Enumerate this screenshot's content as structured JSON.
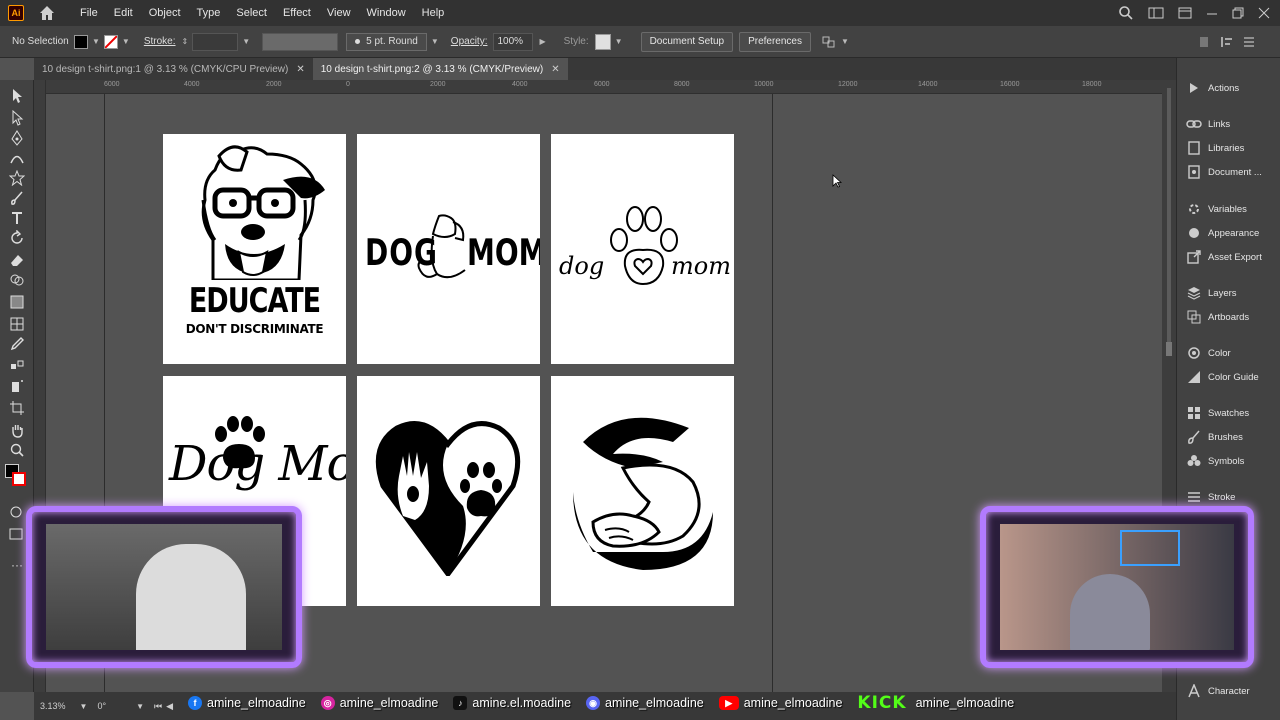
{
  "app": {
    "logo_text": "Ai",
    "menu": [
      "File",
      "Edit",
      "Object",
      "Type",
      "Select",
      "Effect",
      "View",
      "Window",
      "Help"
    ]
  },
  "options_bar": {
    "selection": "No Selection",
    "stroke_label": "Stroke:",
    "brush": "5 pt. Round",
    "opacity_label": "Opacity:",
    "opacity_value": "100%",
    "style_label": "Style:",
    "document_setup": "Document Setup",
    "preferences": "Preferences"
  },
  "tabs": [
    {
      "label": "10 design t-shirt.png:1 @ 3.13 % (CMYK/CPU Preview)",
      "active": false
    },
    {
      "label": "10 design t-shirt.png:2 @ 3.13 % (CMYK/Preview)",
      "active": true
    }
  ],
  "ruler": {
    "labels": [
      "6000",
      "4000",
      "2000",
      "0",
      "2000",
      "4000",
      "6000",
      "8000",
      "10000",
      "12000",
      "14000",
      "16000",
      "18000"
    ]
  },
  "artboards": {
    "a1": {
      "line1": "EDUCATE",
      "line2": "DON'T DISCRIMINATE"
    },
    "a2": {
      "left": "DOG",
      "right": "MOM"
    },
    "a3": {
      "left": "dog",
      "right": "mom"
    },
    "a4": {
      "text": "Dog Mom"
    }
  },
  "right_panel": {
    "items": [
      {
        "label": "Actions",
        "icon": "play-icon"
      },
      {
        "label": "Links",
        "icon": "link-icon"
      },
      {
        "label": "Libraries",
        "icon": "libraries-icon"
      },
      {
        "label": "Document ...",
        "icon": "document-info-icon"
      },
      {
        "label": "Variables",
        "icon": "variables-icon"
      },
      {
        "label": "Appearance",
        "icon": "appearance-icon"
      },
      {
        "label": "Asset Export",
        "icon": "export-icon"
      },
      {
        "label": "Layers",
        "icon": "layers-icon"
      },
      {
        "label": "Artboards",
        "icon": "artboards-icon"
      },
      {
        "label": "Color",
        "icon": "color-icon"
      },
      {
        "label": "Color Guide",
        "icon": "color-guide-icon"
      },
      {
        "label": "Swatches",
        "icon": "swatches-icon"
      },
      {
        "label": "Brushes",
        "icon": "brushes-icon"
      },
      {
        "label": "Symbols",
        "icon": "symbols-icon"
      },
      {
        "label": "Stroke",
        "icon": "stroke-icon"
      },
      {
        "label": "Character",
        "icon": "character-icon"
      }
    ]
  },
  "status": {
    "zoom": "3.13%",
    "rotation": "0°"
  },
  "social": {
    "facebook": "amine_elmoadine",
    "instagram": "amine_elmoadine",
    "tiktok": "amine.el.moadine",
    "discord": "amine_elmoadine",
    "youtube": "amine_elmoadine",
    "kick_label": "KICK",
    "kick": "amine_elmoadine"
  },
  "colors": {
    "accent_purple": "#b27bff",
    "menubar": "#323232",
    "panel": "#424242",
    "canvas": "#535353"
  }
}
